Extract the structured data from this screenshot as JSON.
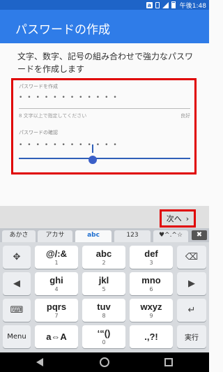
{
  "status_bar": {
    "time": "午後1:48",
    "amazon_icon_letter": "a",
    "icons": [
      "amazon-icon",
      "vibrate-icon",
      "signal-icon",
      "battery-icon"
    ]
  },
  "app_bar": {
    "title": "パスワードの作成"
  },
  "form": {
    "instruction": "文字、数字、記号の組み合わせで強力なパスワードを作成します",
    "password": {
      "label": "パスワードを作成",
      "value_masked": "••••••••••••",
      "hint": "8 文字以上で指定してください",
      "strength": "良好"
    },
    "confirm": {
      "label": "パスワードの確認",
      "value_masked": "••••••••••••"
    }
  },
  "actions": {
    "next_label": "次へ",
    "next_icon": "chevron-right-icon",
    "next_arrow": "›"
  },
  "keyboard": {
    "tabs": [
      "あかさ",
      "アカサ",
      "abc",
      "123",
      "♥^.^☆"
    ],
    "active_tab": "abc",
    "close_icon": "✖",
    "rows": [
      [
        {
          "label": "✥",
          "sub": ""
        },
        {
          "label": "@/:&",
          "sub": "1"
        },
        {
          "label": "abc",
          "sub": "2"
        },
        {
          "label": "def",
          "sub": "3"
        },
        {
          "label": "⌫",
          "sub": ""
        }
      ],
      [
        {
          "label": "◀",
          "sub": ""
        },
        {
          "label": "ghi",
          "sub": "4"
        },
        {
          "label": "jkl",
          "sub": "5"
        },
        {
          "label": "mno",
          "sub": "6"
        },
        {
          "label": "▶",
          "sub": ""
        }
      ],
      [
        {
          "label": "⌨",
          "sub": ""
        },
        {
          "label": "pqrs",
          "sub": "7"
        },
        {
          "label": "tuv",
          "sub": "8"
        },
        {
          "label": "wxyz",
          "sub": "9"
        },
        {
          "label": "↵",
          "sub": ""
        }
      ],
      [
        {
          "label": "Menu",
          "sub": ""
        },
        {
          "label": "a⇔A",
          "sub": ""
        },
        {
          "label": "‘“()",
          "sub": "0"
        },
        {
          "label": ".,?!",
          "sub": ""
        },
        {
          "label": "実行",
          "sub": ""
        }
      ]
    ]
  },
  "nav_bar": {
    "icons": [
      "back-icon",
      "home-icon",
      "recent-apps-icon"
    ]
  },
  "colors": {
    "status_bar": "#1e64c8",
    "app_bar": "#2f7ce8",
    "highlight_box": "#e00000",
    "active_tab": "#1f6fd0"
  }
}
